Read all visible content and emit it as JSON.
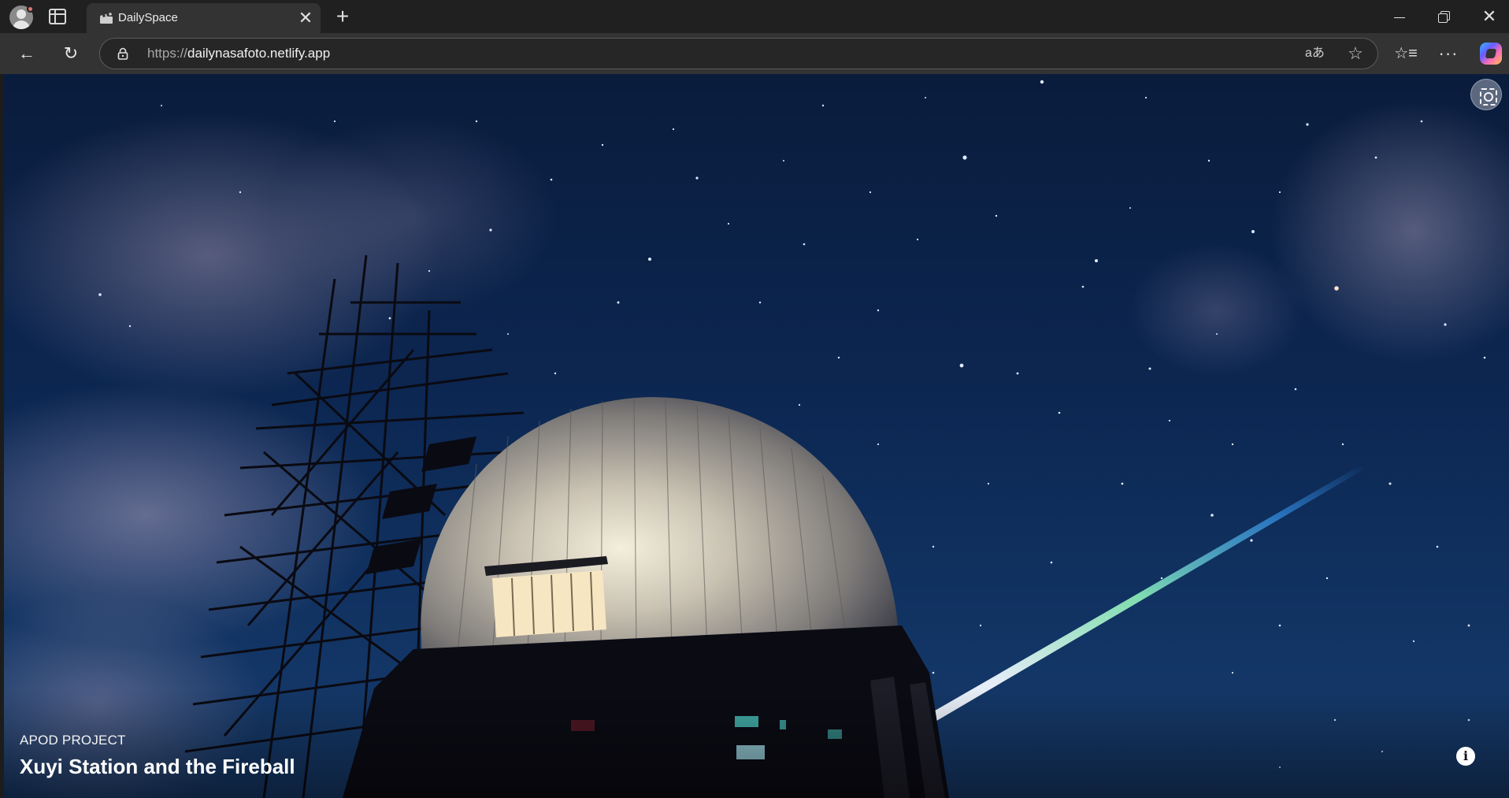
{
  "browser": {
    "tab": {
      "title": "DailySpace",
      "favicon": "film-clapper-icon",
      "close_glyph": "✕"
    },
    "new_tab_glyph": "+",
    "window_controls": {
      "minimize": "minimize-icon",
      "maximize": "restore-icon",
      "close_glyph": "✕"
    },
    "address_bar": {
      "protocol": "https://",
      "host": "dailynasafoto.netlify.app"
    },
    "toolbar_icons": [
      "back-icon",
      "refresh-icon",
      "lock-icon",
      "read-aloud-icon",
      "favorite-star-icon",
      "favorites-icon",
      "more-icon",
      "copilot-icon"
    ],
    "glyphs": {
      "back": "←",
      "refresh": "↻",
      "read_aloud": "aあ",
      "star": "☆",
      "favorites": "☆≡",
      "more": "···"
    }
  },
  "page": {
    "kicker": "APOD PROJECT",
    "title": "Xuyi Station and the Fireball",
    "info_glyph": "i",
    "visual_search_icon": "visual-search-icon",
    "colors": {
      "sky_top": "#0a1c3c",
      "sky_bottom": "#173b6c",
      "meteor_green": "#7fe0a0",
      "meteor_white": "#ffffff"
    }
  }
}
